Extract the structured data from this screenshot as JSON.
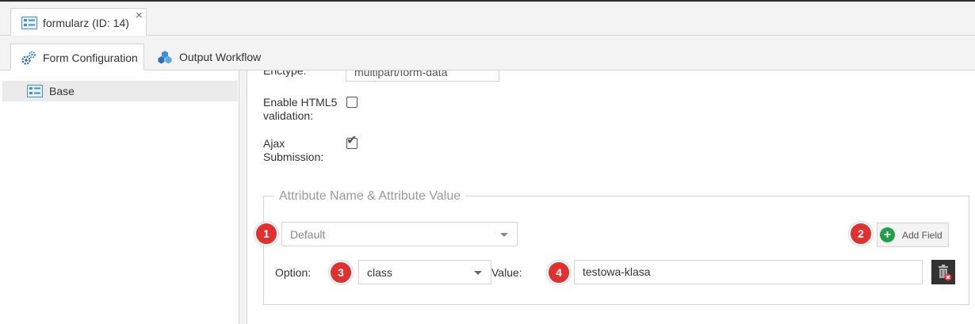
{
  "doc_tab": {
    "title": "formularz (ID: 14)",
    "close_glyph": "×",
    "icon": "form-list-icon"
  },
  "sub_tabs": [
    {
      "label": "Form Configuration",
      "icon": "gears-icon",
      "active": true
    },
    {
      "label": "Output Workflow",
      "icon": "workflow-icon",
      "active": false
    }
  ],
  "tree": {
    "items": [
      {
        "label": "Base",
        "icon": "form-list-icon"
      }
    ]
  },
  "form": {
    "enctype_label": "Enctype:",
    "enctype_value": "multipart/form-data",
    "html5_label_line1": "Enable HTML5",
    "html5_label_line2": "validation:",
    "html5_checked": false,
    "ajax_label_line1": "Ajax",
    "ajax_label_line2": "Submission:",
    "ajax_checked": true,
    "tick_glyph": "✔"
  },
  "attributes": {
    "legend": "Attribute Name & Attribute Value",
    "preset_select": "Default",
    "add_field_label": "Add Field",
    "add_field_glyph": "+",
    "option_label": "Option:",
    "option_value": "class",
    "value_label": "Value:",
    "value_input": "testowa-klasa"
  },
  "badges": [
    "1",
    "2",
    "3",
    "4"
  ],
  "colors": {
    "badge": "#e03030",
    "add_green": "#21a046",
    "delete_bg": "#333333"
  }
}
